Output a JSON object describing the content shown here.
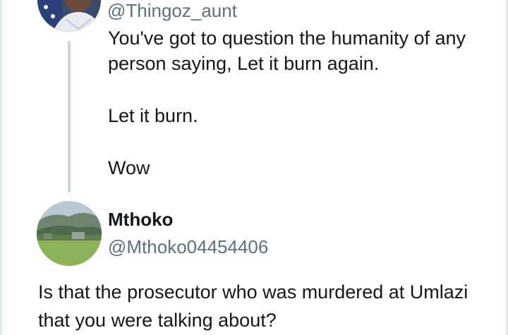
{
  "quoted_tweet": {
    "handle": "@Thingoz_aunt",
    "paragraphs": [
      "You've got to question the humanity of any person saying, Let it burn again.",
      "Let it burn.",
      "Wow"
    ],
    "avatar": "user-avatar-photo"
  },
  "reply": {
    "display_name": "Mthoko",
    "handle": "@Mthoko04454406",
    "text": "Is that the prosecutor who was murdered at Umlazi that you were talking about?",
    "avatar": "landscape-avatar-photo"
  },
  "colors": {
    "text": "#14171a",
    "secondary": "#5b7083",
    "thread_line": "#ccd6dd"
  }
}
